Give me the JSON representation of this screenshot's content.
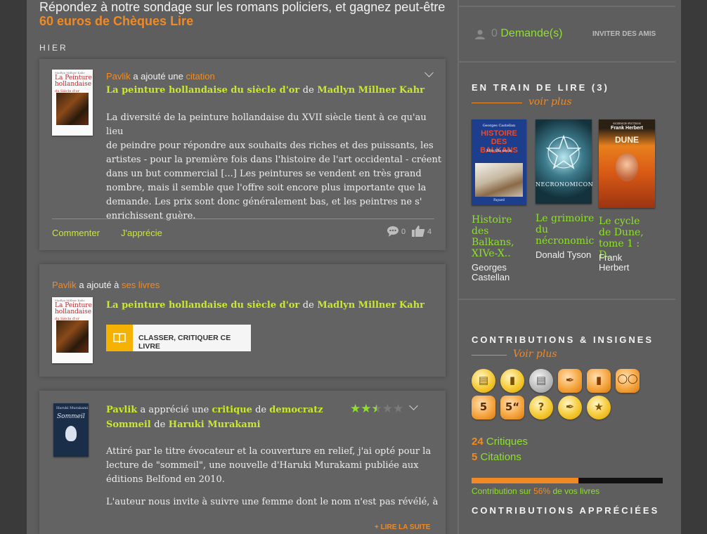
{
  "promo": {
    "line1": "Répondez à notre sondage sur les romans policiers, et gagnez peut-être",
    "line2": "60 euros de Chèques Lire"
  },
  "day_label": "HIER",
  "feed": [
    {
      "user": "Pavlik",
      "action_text": "a ajouté une",
      "action_link": "citation",
      "book_title": "La peinture hollandaise du siècle d'or",
      "de": "de",
      "book_author": "Madlyn Millner Kahr",
      "cover": {
        "author_small": "Madlyn Millner Kahr",
        "title": "La Peinture hollandaise",
        "subtitle": "du Siècle d'or"
      },
      "quote": [
        "La diversité de la peinture hollandaise du XVII siècle tient à ce qu'au lieu",
        "de peindre pour répondre aux souhaits des riches et des puissants, les",
        "artistes - pour la première fois dans l'histoire de l'art occidental - créent",
        "dans un but commercial [...] Les peintures se vendent en très grand",
        "nombre, mais il semble que l'offre soit encore plus importante que la",
        "demande. Les prix sont donc généralement bas, et les peintres ne s'",
        "enrichissent guère."
      ],
      "comment_label": "Commenter",
      "like_label": "J'apprécie",
      "comments_count": "0",
      "likes_count": "4"
    },
    {
      "user": "Pavlik",
      "action_text": "a ajouté à",
      "action_link": "ses livres",
      "book_title": "La peinture hollandaise du siècle d'or",
      "de": "de",
      "book_author": "Madlyn Millner Kahr",
      "button_label": "CLASSER, CRITIQUER CE LIVRE"
    },
    {
      "user": "Pavlik",
      "action_text": "a apprécié une",
      "action_link": "critique",
      "de1": "de",
      "critic": "democratz",
      "book_title": "Sommeil",
      "de2": "de",
      "book_author": "Haruki Murakami",
      "cover": {
        "author_small": "Haruki Murakami",
        "title": "Sommeil"
      },
      "rating": 2.5,
      "rating_max": 5,
      "review": [
        "Attiré par le titre évocateur et la couverture en relief, j'ai opté pour la",
        "lecture de \"sommeil\", une nouvelle d'Haruki Murakami publiée aux",
        "éditions Belfond en 2010."
      ],
      "review2": "L'auteur nous invite à suivre une femme dont le nom n'est pas révélé, à",
      "read_more": "+ LIRE LA SUITE"
    }
  ],
  "friends": {
    "count": "0",
    "label": "Demande(s)",
    "invite": "INVITER DES AMIS"
  },
  "reading": {
    "title": "EN TRAIN DE LIRE (3)",
    "voir_plus": "voir plus",
    "books": [
      {
        "title": "Histoire des Balkans, XIVe-X..",
        "author": "Georges Castellan",
        "cover_title": "HISTOIRE DES BALKANS",
        "cover_top": "Georges Castellan",
        "cover_sub": "XIVe-XXe siècle",
        "cover_pub": "Fayard",
        "color": "#1d3e8c"
      },
      {
        "title": "Le grimoire du nécronomic",
        "author": "Donald Tyson",
        "cover_title": "NECRONOMICON",
        "color": "#1b3c48"
      },
      {
        "title": "Le cycle de Dune, tome 1 : D..",
        "author": "Frank Herbert",
        "cover_top": "Frank Herbert",
        "cover_title": "DUNE",
        "cover_label": "SCIENCE-FICTION",
        "color": "#e07a1c"
      }
    ]
  },
  "contributions": {
    "title": "CONTRIBUTIONS & INSIGNES",
    "voir_plus": "Voir plus",
    "badges": [
      "books-stack",
      "book-open",
      "books-gray",
      "feather",
      "book-orange",
      "glasses",
      "quote-5",
      "critic-5",
      "question",
      "pen",
      "medal"
    ],
    "critiques_count": "24",
    "critiques_label": "Critiques",
    "citations_count": "5",
    "citations_label": "Citations",
    "progress_percent": 56,
    "progress_text_a": "Contribution sur",
    "progress_text_pct": "56%",
    "progress_text_b": "de vos livres",
    "appreciated_title": "CONTRIBUTIONS APPRÉCIÉES"
  },
  "colors": {
    "accent_orange": "#f08a24",
    "link_green": "#c9ea2a",
    "title_green": "#8ee02c",
    "panel": "#5e5e5e"
  }
}
